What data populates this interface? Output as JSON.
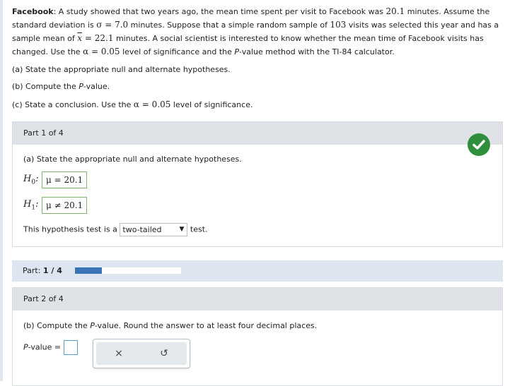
{
  "problem": {
    "title": "Facebook",
    "text1": ": A study showed that two years ago, the mean time spent per visit to Facebook was ",
    "mean_old": "20.1",
    "text2": " minutes. Assume the standard deviation is ",
    "sigma_expr": "σ = 7.0",
    "text3": " minutes. Suppose that a simple random sample of ",
    "n": "103",
    "text4": " visits was selected this year and has a sample mean of ",
    "xbar_sym": "x",
    "xbar_val": " = 22.1",
    "text5": " minutes. A social scientist is interested to know whether the mean time of Facebook visits has changed. Use the ",
    "alpha_expr": "α = 0.05",
    "text6": " level of significance and the ",
    "pvalue_word": "P",
    "text7": "-value method with the TI-84 calculator."
  },
  "questions": {
    "a": "(a) State the appropriate null and alternate hypotheses.",
    "b_pre": "(b) Compute the ",
    "b_p": "P",
    "b_post": "-value.",
    "c_pre": "(c) State a conclusion. Use the ",
    "c_alpha": "α = 0.05",
    "c_post": " level of significance."
  },
  "part1": {
    "header": "Part 1 of 4",
    "prompt": "(a) State the appropriate null and alternate hypotheses.",
    "h0_label": "H",
    "h0_sub": "0",
    "h0_value": "μ = 20.1",
    "h1_label": "H",
    "h1_sub": "1",
    "h1_value": "μ ≠ 20.1",
    "test_pre": "This hypothesis test is a",
    "test_selected": "two-tailed",
    "test_post": "test.",
    "status_icon": "check-circle-icon",
    "status_color": "#2f8f3c"
  },
  "progress": {
    "label": "Part:",
    "value": "1 / 4",
    "fraction": 0.25,
    "fill_color": "#3973b4"
  },
  "part2": {
    "header": "Part 2 of 4",
    "prompt_pre": "(b) Compute the ",
    "prompt_p": "P",
    "prompt_post": "-value. Round the answer to at least four decimal places.",
    "pvalue_p": "P",
    "pvalue_label": "-value =",
    "pvalue_input": "",
    "clear_symbol": "×",
    "undo_symbol": "↺"
  }
}
